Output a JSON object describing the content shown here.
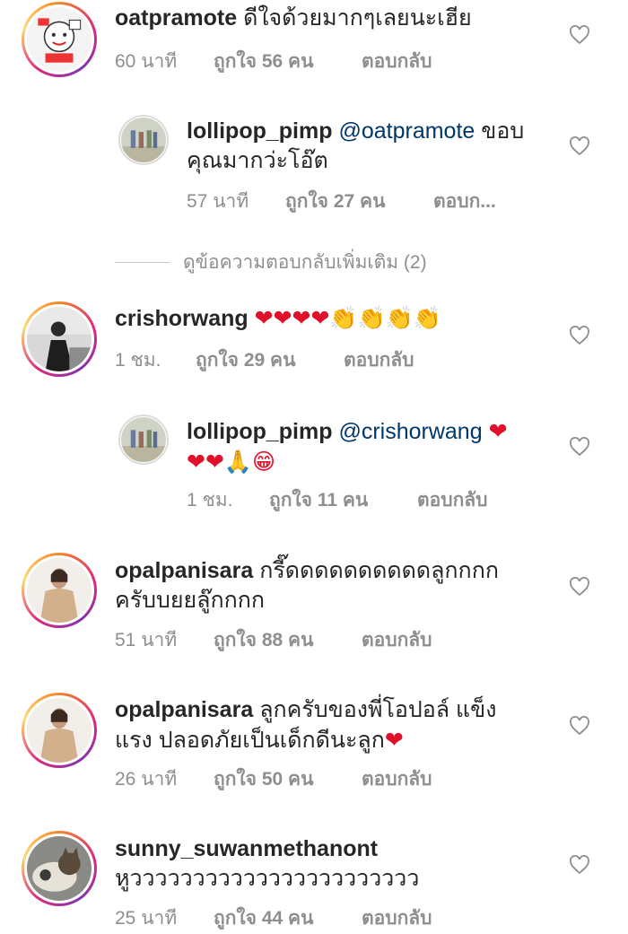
{
  "comments": [
    {
      "username": "oatpramote",
      "text": "ดีใจด้วยมากๆเลยนะเฮีย",
      "time": "60 นาที",
      "likes": "ถูกใจ 56 คน",
      "reply": "ตอบกลับ"
    },
    {
      "username": "lollipop_pimp",
      "mention": "@oatpramote",
      "text_line1": " ขอบ",
      "text_line2": "คุณมากว่ะโอ๊ต",
      "time": "57 นาที",
      "likes": "ถูกใจ 27 คน",
      "reply": "ตอบก..."
    },
    {
      "username": "crishorwang",
      "emoji": "❤❤❤❤👏👏👏👏",
      "time": "1 ชม.",
      "likes": "ถูกใจ 29 คน",
      "reply": "ตอบกลับ"
    },
    {
      "username": "lollipop_pimp",
      "mention": "@crishorwang",
      "emoji_line1": "❤",
      "emoji_line2": "❤❤🙏😁",
      "time": "1 ชม.",
      "likes": "ถูกใจ 11 คน",
      "reply": "ตอบกลับ"
    },
    {
      "username": "opalpanisara",
      "text_line1": "กรี๊ดดดดดดดดดดลูกกกก",
      "text_line2": "ครับบยยลู๊กกกก",
      "time": "51 นาที",
      "likes": "ถูกใจ 88 คน",
      "reply": "ตอบกลับ"
    },
    {
      "username": "opalpanisara",
      "text_line1": "ลูกครับของพี่โอปอล์ แข็ง",
      "text_line2": "แรง ปลอดภัยเป็นเด็กดีนะลูก",
      "text_emoji": "❤",
      "time": "26 นาที",
      "likes": "ถูกใจ 50 คน",
      "reply": "ตอบกลับ"
    },
    {
      "username": "sunny_suwanmethanont",
      "text_line2": "หูววววววววววววววววววววววว",
      "time": "25 นาที",
      "likes": "ถูกใจ 44 คน",
      "reply": "ตอบกลับ"
    }
  ],
  "view_more_replies": "ดูข้อความตอบกลับเพิ่มเติม (2)",
  "colors": {
    "username": "#262626",
    "meta": "#8e8e8e",
    "mention": "#00376b",
    "heart": "#e0102a"
  }
}
